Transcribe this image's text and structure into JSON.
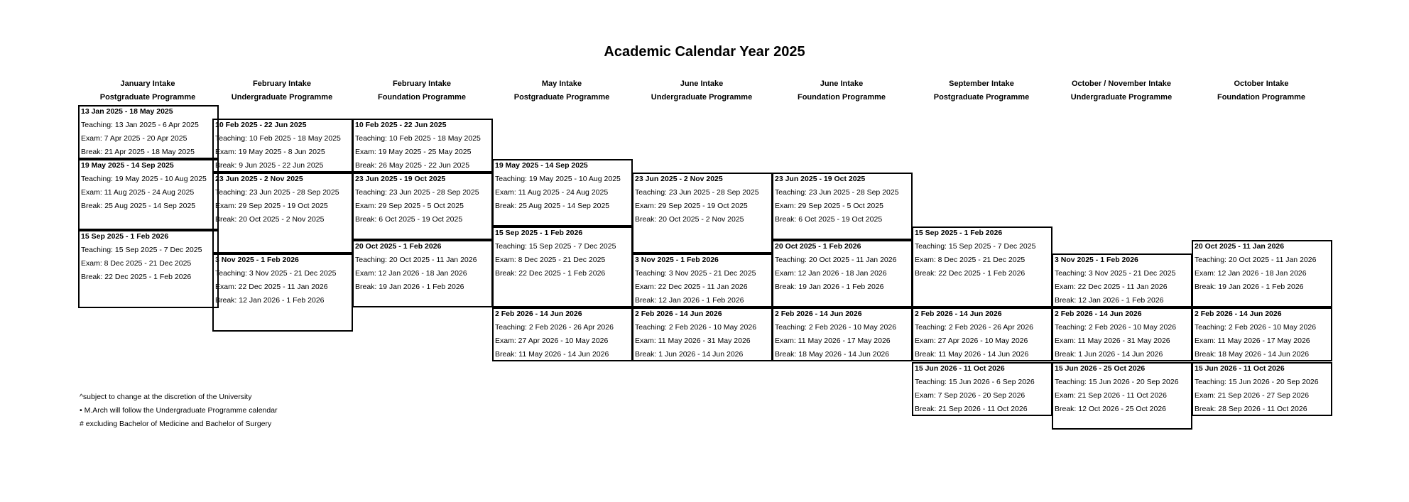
{
  "title": "Academic Calendar Year 2025",
  "columns": [
    {
      "intake": "January Intake",
      "programme": "Postgraduate Programme",
      "blocks": [
        {
          "range": "13 Jan 2025 - 18 May 2025",
          "lines": [
            "Teaching: 13 Jan 2025 - 6 Apr 2025",
            "Exam: 7 Apr 2025 - 20 Apr 2025",
            "Break: 21 Apr 2025 - 18 May 2025"
          ]
        },
        {
          "range": "19 May 2025 - 14 Sep 2025",
          "lines": [
            "Teaching: 19 May 2025 - 10 Aug 2025",
            "Exam: 11 Aug 2025 - 24 Aug 2025",
            "Break: 25 Aug 2025 - 14 Sep 2025"
          ]
        },
        {
          "range": "15 Sep 2025 - 1 Feb 2026",
          "lines": [
            "Teaching: 15 Sep 2025 - 7 Dec 2025",
            "Exam: 8 Dec 2025 - 21 Dec 2025",
            "Break: 22 Dec 2025 - 1 Feb 2026"
          ]
        }
      ]
    },
    {
      "intake": "February Intake",
      "programme": "Undergraduate Programme",
      "blocks": [
        {
          "range": "10 Feb 2025 - 22 Jun 2025",
          "lines": [
            "Teaching: 10 Feb 2025 - 18 May 2025",
            "Exam: 19 May 2025 - 8 Jun 2025",
            "Break: 9 Jun 2025 - 22 Jun 2025"
          ]
        },
        {
          "range": "23 Jun 2025 - 2 Nov 2025",
          "lines": [
            "Teaching: 23 Jun 2025 - 28 Sep 2025",
            "Exam: 29 Sep 2025 - 19 Oct 2025",
            "Break: 20 Oct 2025 - 2 Nov 2025"
          ]
        },
        {
          "range": "3 Nov 2025 - 1 Feb 2026",
          "lines": [
            "Teaching: 3 Nov 2025 - 21 Dec 2025",
            "Exam: 22 Dec 2025 - 11 Jan 2026",
            "Break: 12 Jan 2026 - 1 Feb 2026"
          ]
        }
      ]
    },
    {
      "intake": "February Intake",
      "programme": "Foundation Programme",
      "blocks": [
        {
          "range": "10 Feb 2025 - 22 Jun 2025",
          "lines": [
            "Teaching: 10 Feb 2025 - 18 May 2025",
            "Exam: 19 May 2025 - 25 May 2025",
            "Break: 26 May 2025 - 22 Jun 2025"
          ]
        },
        {
          "range": "23 Jun 2025 - 19 Oct 2025",
          "lines": [
            "Teaching: 23 Jun 2025 - 28 Sep 2025",
            "Exam: 29 Sep 2025 - 5 Oct 2025",
            "Break: 6 Oct 2025 - 19 Oct 2025"
          ]
        },
        {
          "range": "20 Oct 2025 - 1 Feb 2026",
          "lines": [
            "Teaching: 20 Oct 2025 - 11 Jan 2026",
            "Exam: 12 Jan 2026 - 18 Jan 2026",
            "Break: 19 Jan 2026 - 1 Feb 2026"
          ]
        }
      ]
    },
    {
      "intake": "May Intake",
      "programme": "Postgraduate Programme",
      "blocks": [
        {
          "range": "19 May 2025 - 14 Sep 2025",
          "lines": [
            "Teaching: 19 May 2025 - 10 Aug 2025",
            "Exam: 11 Aug 2025 - 24 Aug 2025",
            "Break: 25 Aug 2025 - 14 Sep 2025"
          ]
        },
        {
          "range": "15 Sep 2025 - 1 Feb 2026",
          "lines": [
            "Teaching: 15 Sep 2025 - 7 Dec 2025",
            "Exam: 8 Dec 2025 - 21 Dec 2025",
            "Break: 22 Dec 2025 - 1 Feb 2026"
          ]
        },
        {
          "range": "2 Feb 2026 - 14 Jun 2026",
          "lines": [
            "Teaching: 2 Feb 2026 - 26 Apr 2026",
            "Exam: 27 Apr 2026 - 10 May 2026",
            "Break: 11 May 2026 - 14 Jun 2026"
          ]
        }
      ]
    },
    {
      "intake": "June Intake",
      "programme": "Undergraduate Programme",
      "blocks": [
        {
          "range": "23 Jun 2025 - 2 Nov 2025",
          "lines": [
            "Teaching: 23 Jun 2025 - 28 Sep 2025",
            "Exam: 29 Sep 2025 - 19 Oct 2025",
            "Break: 20 Oct 2025 - 2 Nov 2025"
          ]
        },
        {
          "range": "3 Nov 2025 - 1 Feb 2026",
          "lines": [
            "Teaching: 3 Nov 2025 - 21 Dec 2025",
            "Exam: 22 Dec 2025 - 11 Jan 2026",
            "Break: 12 Jan 2026 - 1 Feb 2026"
          ]
        },
        {
          "range": "2 Feb 2026 - 14 Jun 2026",
          "lines": [
            "Teaching: 2 Feb 2026 - 10 May 2026",
            "Exam: 11 May 2026 - 31 May 2026",
            "Break: 1 Jun 2026 - 14 Jun 2026"
          ]
        }
      ]
    },
    {
      "intake": "June Intake",
      "programme": "Foundation Programme",
      "blocks": [
        {
          "range": "23 Jun 2025 - 19 Oct 2025",
          "lines": [
            "Teaching: 23 Jun 2025 - 28 Sep 2025",
            "Exam: 29 Sep 2025 - 5 Oct 2025",
            "Break: 6 Oct 2025 - 19 Oct 2025"
          ]
        },
        {
          "range": "20 Oct 2025 - 1 Feb 2026",
          "lines": [
            "Teaching: 20 Oct 2025 - 11 Jan 2026",
            "Exam: 12 Jan 2026 - 18 Jan 2026",
            "Break: 19 Jan 2026 - 1 Feb 2026"
          ]
        },
        {
          "range": "2 Feb 2026 - 14 Jun 2026",
          "lines": [
            "Teaching: 2 Feb 2026 - 10 May 2026",
            "Exam: 11 May 2026 - 17 May 2026",
            "Break: 18 May 2026 - 14 Jun 2026"
          ]
        }
      ]
    },
    {
      "intake": "September Intake",
      "programme": "Postgraduate Programme",
      "blocks": [
        {
          "range": "15 Sep 2025 - 1 Feb 2026",
          "lines": [
            "Teaching: 15 Sep 2025 - 7 Dec 2025",
            "Exam: 8 Dec 2025 - 21 Dec 2025",
            "Break: 22 Dec 2025 - 1 Feb 2026"
          ]
        },
        {
          "range": "2 Feb 2026 - 14 Jun 2026",
          "lines": [
            "Teaching: 2 Feb 2026 - 26 Apr 2026",
            "Exam: 27 Apr 2026 - 10 May 2026",
            "Break: 11 May 2026 - 14 Jun 2026"
          ]
        },
        {
          "range": "15 Jun 2026 - 11 Oct 2026",
          "lines": [
            "Teaching: 15 Jun 2026 - 6 Sep 2026",
            "Exam: 7 Sep 2026 - 20 Sep 2026",
            "Break: 21 Sep 2026 - 11 Oct 2026"
          ]
        }
      ]
    },
    {
      "intake": "October / November Intake",
      "programme": "Undergraduate Programme",
      "blocks": [
        {
          "range": "3 Nov 2025 - 1 Feb 2026",
          "lines": [
            "Teaching: 3 Nov 2025 - 21 Dec 2025",
            "Exam: 22 Dec 2025 - 11 Jan 2026",
            "Break: 12 Jan 2026 - 1 Feb 2026"
          ]
        },
        {
          "range": "2 Feb 2026 - 14 Jun 2026",
          "lines": [
            "Teaching: 2 Feb 2026 - 10 May 2026",
            "Exam: 11 May 2026 - 31 May 2026",
            "Break: 1 Jun 2026 - 14 Jun 2026"
          ]
        },
        {
          "range": "15 Jun 2026 - 25 Oct 2026",
          "lines": [
            "Teaching: 15 Jun 2026 - 20 Sep 2026",
            "Exam: 21 Sep 2026 - 11 Oct 2026",
            "Break: 12 Oct 2026 - 25 Oct 2026"
          ]
        }
      ]
    },
    {
      "intake": "October Intake",
      "programme": "Foundation Programme",
      "blocks": [
        {
          "range": "20 Oct 2025 - 11 Jan 2026",
          "lines": [
            "Teaching: 20 Oct 2025 - 11 Jan 2026",
            "Exam: 12 Jan 2026 - 18 Jan 2026",
            "Break: 19 Jan 2026 - 1 Feb 2026"
          ]
        },
        {
          "range": "2 Feb 2026 - 14 Jun 2026",
          "lines": [
            "Teaching: 2 Feb 2026 - 10 May 2026",
            "Exam: 11 May 2026 - 17 May 2026",
            "Break: 18 May 2026 - 14 Jun 2026"
          ]
        },
        {
          "range": "15 Jun 2026 - 11 Oct 2026",
          "lines": [
            "Teaching: 15 Jun 2026 - 20 Sep 2026",
            "Exam: 21 Sep 2026 - 27 Sep 2026",
            "Break: 28 Sep 2026 - 11 Oct 2026"
          ]
        }
      ]
    }
  ],
  "notes": [
    "^subject to change at the discretion of the University",
    "• M.Arch will follow the Undergraduate Programme calendar",
    "# excluding Bachelor of Medicine and Bachelor of Surgery"
  ]
}
